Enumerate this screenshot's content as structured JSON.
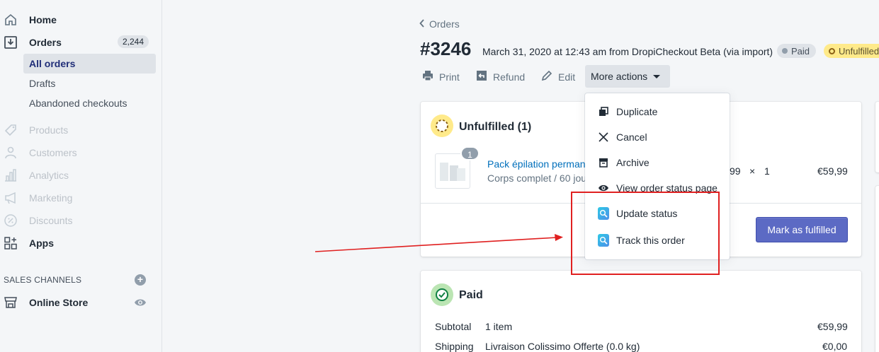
{
  "sidebar": {
    "items": [
      {
        "label": "Home",
        "icon": "home-icon"
      },
      {
        "label": "Orders",
        "icon": "orders-icon",
        "count": "2,244"
      },
      {
        "label": "Products",
        "icon": "tag-icon"
      },
      {
        "label": "Customers",
        "icon": "person-icon"
      },
      {
        "label": "Analytics",
        "icon": "bar-chart-icon"
      },
      {
        "label": "Marketing",
        "icon": "megaphone-icon"
      },
      {
        "label": "Discounts",
        "icon": "discount-icon"
      },
      {
        "label": "Apps",
        "icon": "apps-icon"
      }
    ],
    "orders_sub": [
      "All orders",
      "Drafts",
      "Abandoned checkouts"
    ],
    "sales_channels_heading": "SALES CHANNELS",
    "online_store": "Online Store"
  },
  "header": {
    "back_label": "Orders",
    "order_number": "#3246",
    "order_meta": "March 31, 2020 at 12:43 am from DropiCheckout Beta (via import)",
    "paid_badge": "Paid",
    "unfulfilled_badge": "Unfulfilled"
  },
  "actions": {
    "print": "Print",
    "refund": "Refund",
    "edit": "Edit",
    "more": "More actions"
  },
  "dropdown": {
    "items": [
      {
        "label": "Duplicate",
        "icon": "duplicate-icon"
      },
      {
        "label": "Cancel",
        "icon": "close-icon"
      },
      {
        "label": "Archive",
        "icon": "archive-icon"
      },
      {
        "label": "View order status page",
        "icon": "eye-icon"
      },
      {
        "label": "Update status",
        "icon": "app-search-icon"
      },
      {
        "label": "Track this order",
        "icon": "app-search-icon"
      }
    ]
  },
  "unfulfilled_card": {
    "title": "Unfulfilled (1)",
    "qty": "1",
    "product_name": "Pack épilation perman",
    "variant": "Corps complet / 60 jou",
    "unit_price": "99",
    "times": "×",
    "quantity": "1",
    "total": "€59,99",
    "mark_button": "Mark as fulfilled"
  },
  "paid_card": {
    "title": "Paid",
    "rows": [
      {
        "label": "Subtotal",
        "desc": "1 item",
        "value": "€59,99"
      },
      {
        "label": "Shipping",
        "desc": "Livraison Colissimo Offerte (0.0 kg)",
        "value": "€0,00"
      }
    ]
  },
  "colors": {
    "accent": "#5c6ac4",
    "annotation": "#e02020",
    "unfulfilled_badge": "#ffea8a",
    "link": "#006fbb"
  }
}
